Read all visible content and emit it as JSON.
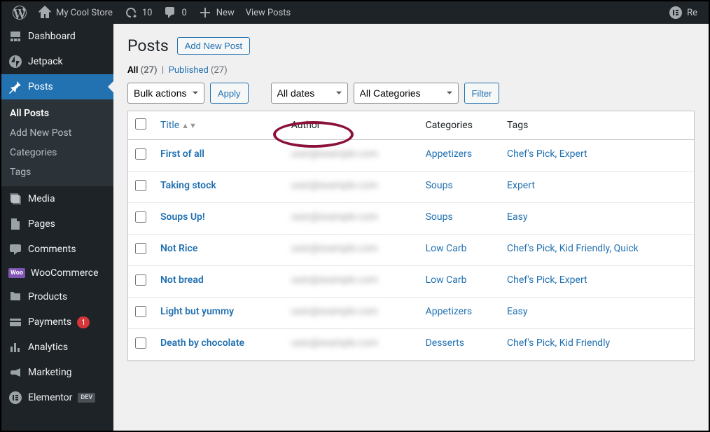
{
  "adminbar": {
    "site_name": "My Cool Store",
    "updates": "10",
    "comments": "0",
    "new": "New",
    "view_posts": "View Posts",
    "right": "Re"
  },
  "sidebar": {
    "dashboard": "Dashboard",
    "jetpack": "Jetpack",
    "posts": "Posts",
    "submenu": {
      "all_posts": "All Posts",
      "add_new": "Add New Post",
      "categories": "Categories",
      "tags": "Tags"
    },
    "media": "Media",
    "pages": "Pages",
    "comments": "Comments",
    "woocommerce": "WooCommerce",
    "products": "Products",
    "payments": "Payments",
    "payments_badge": "1",
    "analytics": "Analytics",
    "marketing": "Marketing",
    "elementor": "Elementor",
    "elementor_badge": "DEV"
  },
  "page": {
    "title": "Posts",
    "add_new": "Add New Post"
  },
  "filters": {
    "all_label": "All",
    "all_count": "(27)",
    "published_label": "Published",
    "published_count": "(27)",
    "bulk_actions": "Bulk actions",
    "apply": "Apply",
    "all_dates": "All dates",
    "all_categories": "All Categories",
    "filter": "Filter"
  },
  "table": {
    "headers": {
      "title": "Title",
      "author": "Author",
      "categories": "Categories",
      "tags": "Tags"
    },
    "rows": [
      {
        "title": "First of all",
        "author": "user@example.com",
        "categories": "Appetizers",
        "tags": "Chef's Pick, Expert"
      },
      {
        "title": "Taking stock",
        "author": "user@example.com",
        "categories": "Soups",
        "tags": "Expert"
      },
      {
        "title": "Soups Up!",
        "author": "user@example.com",
        "categories": "Soups",
        "tags": "Easy"
      },
      {
        "title": "Not Rice",
        "author": "user@example.com",
        "categories": "Low Carb",
        "tags": "Chef's Pick, Kid Friendly, Quick"
      },
      {
        "title": "Not bread",
        "author": "user@example.com",
        "categories": "Low Carb",
        "tags": "Chef's Pick, Expert"
      },
      {
        "title": "Light but yummy",
        "author": "user@example.com",
        "categories": "Appetizers",
        "tags": "Easy"
      },
      {
        "title": "Death by chocolate",
        "author": "user@example.com",
        "categories": "Desserts",
        "tags": "Chef's Pick, Kid Friendly"
      }
    ]
  }
}
